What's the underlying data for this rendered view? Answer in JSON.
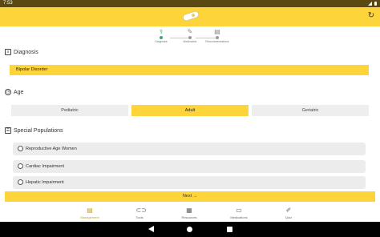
{
  "status_bar": {
    "time": "7:53"
  },
  "stepper": {
    "steps": [
      {
        "label": "Diagnosis",
        "active": true
      },
      {
        "label": "Medication",
        "active": false
      },
      {
        "label": "Recommendations",
        "active": false
      }
    ]
  },
  "diagnosis": {
    "title": "Diagnosis",
    "value": "Bipolar Disorder"
  },
  "age": {
    "title": "Age",
    "options": [
      "Pediatric",
      "Adult",
      "Geriatric"
    ],
    "selected": "Adult"
  },
  "special_populations": {
    "title": "Special Populations",
    "items": [
      "Reproductive Age Women",
      "Cardiac Impairment",
      "Hepatic Impairment"
    ]
  },
  "next_button": {
    "label": "Next →"
  },
  "bottom_nav": {
    "items": [
      {
        "label": "Management",
        "icon": "clipboard-icon",
        "active": true
      },
      {
        "label": "Tools",
        "icon": "pill-icon",
        "active": false
      },
      {
        "label": "Resources",
        "icon": "book-icon",
        "active": false
      },
      {
        "label": "Medications",
        "icon": "capsule-icon",
        "active": false
      },
      {
        "label": "Quiz",
        "icon": "quiz-icon",
        "active": false
      }
    ]
  },
  "colors": {
    "accent": "#fdd53b",
    "status_bar": "#5a4a12",
    "active_step": "#3aa87a"
  }
}
